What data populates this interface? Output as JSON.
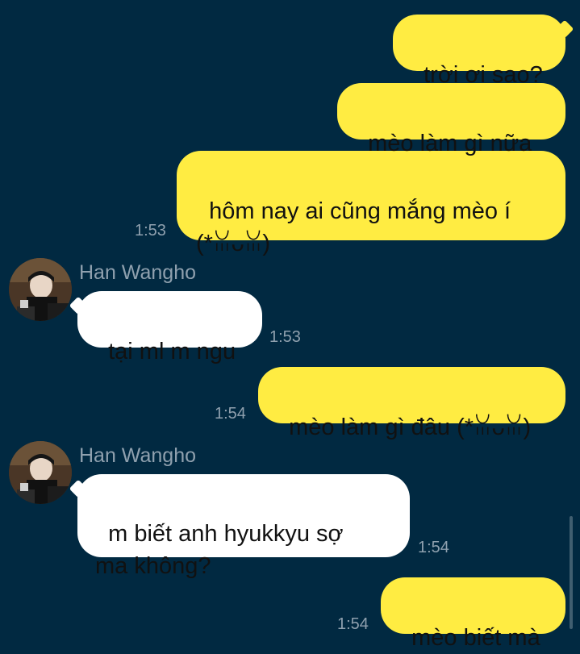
{
  "chat": {
    "messages": [
      {
        "from": "me",
        "text": "trời ơi sao?"
      },
      {
        "from": "me",
        "text": "mèo làm gì nữa"
      },
      {
        "from": "me",
        "text": "hôm nay ai cũng mắng mèo í\n(*ꈍᴗꈍ)",
        "time": "1:53"
      },
      {
        "from": "them",
        "sender": "Han Wangho",
        "text": "tại ml m ngu",
        "time": "1:53"
      },
      {
        "from": "me",
        "text": "mèo làm gì đâu (*ꈍᴗꈍ)",
        "time": "1:54"
      },
      {
        "from": "them",
        "sender": "Han Wangho",
        "text": "m biết anh hyukkyu sợ\nma không?",
        "time": "1:54"
      },
      {
        "from": "me",
        "text": "mèo biết mà",
        "time": "1:54"
      }
    ]
  },
  "colors": {
    "background": "#012941",
    "my_bubble": "#FFEC42",
    "their_bubble": "#FFFFFF",
    "meta_text": "#8FA0AE"
  },
  "icons": {
    "avatar": "avatar-photo"
  }
}
